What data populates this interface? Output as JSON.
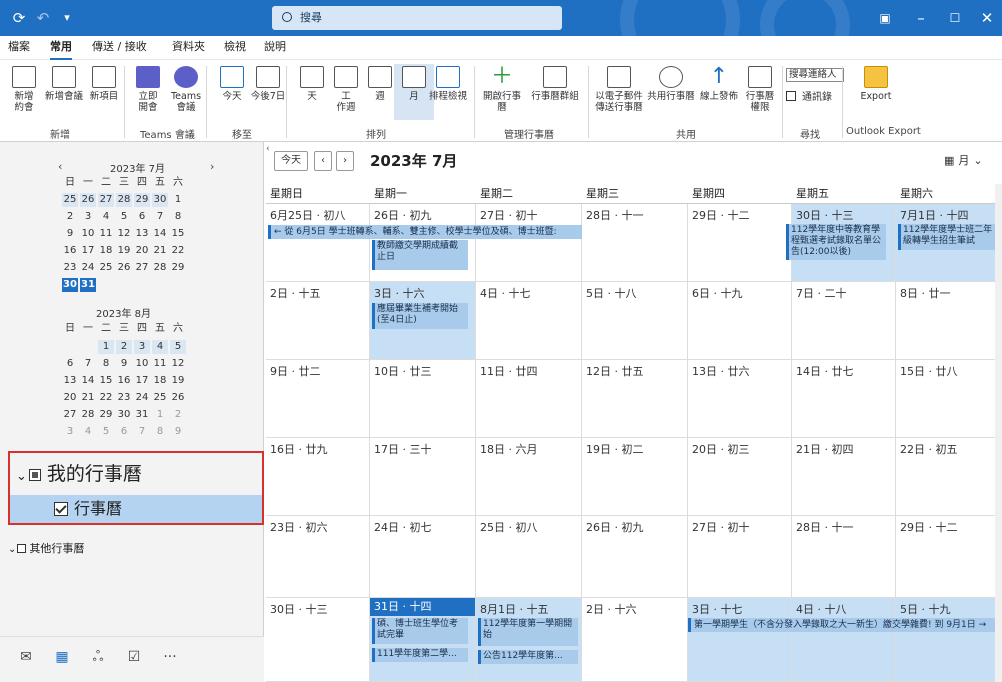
{
  "titlebar": {
    "search_placeholder": "搜尋"
  },
  "menu": [
    "檔案",
    "常用",
    "傳送 / 接收",
    "資料夾",
    "檢視",
    "說明"
  ],
  "ribbon": {
    "buttons": [
      {
        "label": "新增\n約會"
      },
      {
        "label": "新增會議"
      },
      {
        "label": "新項目"
      },
      {
        "label": "立即\n開會"
      },
      {
        "label": "Teams\n會議"
      },
      {
        "label": "今天"
      },
      {
        "label": "今後7日"
      },
      {
        "label": "天"
      },
      {
        "label": "工\n作週"
      },
      {
        "label": "週"
      },
      {
        "label": "月"
      },
      {
        "label": "排程檢視"
      },
      {
        "label": "開啟行事曆"
      },
      {
        "label": "行事曆群組"
      },
      {
        "label": "以電子郵件\n傳送行事曆"
      },
      {
        "label": "共用行事曆"
      },
      {
        "label": "線上發佈"
      },
      {
        "label": "行事曆\n權限"
      },
      {
        "label": "Export"
      }
    ],
    "search_people": "搜尋連絡人",
    "address_book": "通訊錄",
    "groups": [
      "新增",
      "Teams 會議",
      "移至",
      "排列",
      "管理行事曆",
      "共用",
      "尋找",
      "Outlook Export"
    ]
  },
  "mini_cal": {
    "july_title": "2023年 7月",
    "aug_title": "2023年 8月",
    "weekdays": [
      "日",
      "一",
      "二",
      "三",
      "四",
      "五",
      "六"
    ],
    "july_weeks": [
      [
        "25",
        "26",
        "27",
        "28",
        "29",
        "30",
        "1"
      ],
      [
        "2",
        "3",
        "4",
        "5",
        "6",
        "7",
        "8"
      ],
      [
        "9",
        "10",
        "11",
        "12",
        "13",
        "14",
        "15"
      ],
      [
        "16",
        "17",
        "18",
        "19",
        "20",
        "21",
        "22"
      ],
      [
        "23",
        "24",
        "25",
        "26",
        "27",
        "28",
        "29"
      ],
      [
        "30",
        "31"
      ]
    ],
    "aug_weeks": [
      [
        "",
        "",
        "1",
        "2",
        "3",
        "4",
        "5"
      ],
      [
        "6",
        "7",
        "8",
        "9",
        "10",
        "11",
        "12"
      ],
      [
        "13",
        "14",
        "15",
        "16",
        "17",
        "18",
        "19"
      ],
      [
        "20",
        "21",
        "22",
        "23",
        "24",
        "25",
        "26"
      ],
      [
        "27",
        "28",
        "29",
        "30",
        "31",
        "1",
        "2"
      ],
      [
        "3",
        "4",
        "5",
        "6",
        "7",
        "8",
        "9"
      ]
    ]
  },
  "folders": {
    "my_calendars": "我的行事曆",
    "calendar": "行事曆",
    "other_calendars": "其他行事曆"
  },
  "calendar": {
    "today_btn": "今天",
    "title": "2023年 7月",
    "view": "月",
    "weekdays": [
      "星期日",
      "星期一",
      "星期二",
      "星期三",
      "星期四",
      "星期五",
      "星期六"
    ],
    "weeks": [
      [
        "6月25日 · 初八",
        "26日 · 初九",
        "27日 · 初十",
        "28日 · 十一",
        "29日 · 十二",
        "30日 · 十三",
        "7月1日 · 十四"
      ],
      [
        "2日 · 十五",
        "3日 · 十六",
        "4日 · 十七",
        "5日 · 十八",
        "6日 · 十九",
        "7日 · 二十",
        "8日 · 廿一"
      ],
      [
        "9日 · 廿二",
        "10日 · 廿三",
        "11日 · 廿四",
        "12日 · 廿五",
        "13日 · 廿六",
        "14日 · 廿七",
        "15日 · 廿八"
      ],
      [
        "16日 · 廿九",
        "17日 · 三十",
        "18日 · 六月",
        "19日 · 初二",
        "20日 · 初三",
        "21日 · 初四",
        "22日 · 初五"
      ],
      [
        "23日 · 初六",
        "24日 · 初七",
        "25日 · 初八",
        "26日 · 初九",
        "27日 · 初十",
        "28日 · 十一",
        "29日 · 十二"
      ],
      [
        "30日 · 十三",
        "31日 · 十四",
        "8月1日 · 十五",
        "2日 · 十六",
        "3日 · 十七",
        "4日 · 十八",
        "5日 · 十九"
      ]
    ],
    "events": {
      "w1_banner": "← 從 6月5日 學士班轉系、輔系、雙主修、校學士學位及碩、博士班暨:",
      "w1_mon": "教師繳交學期成績截止日",
      "w1_fri": "112學年度中等教育學程甄選考試錄取名單公告(12:00以後)",
      "w1_sat": "112學年度學士班二年級轉學生招生筆試",
      "w2_mon": "應屆畢業生補考開始(至4日止)",
      "w6_mon1": "碩、博士班生學位考試完畢",
      "w6_mon2": "111學年度第二學...",
      "w6_tue1": "112學年度第一學期開始",
      "w6_tue2": "公告112學年度第...",
      "w6_banner": "第一學期學生（不含分發入學錄取之大一新生）繳交學雜費! 到 9月1日 →"
    }
  }
}
